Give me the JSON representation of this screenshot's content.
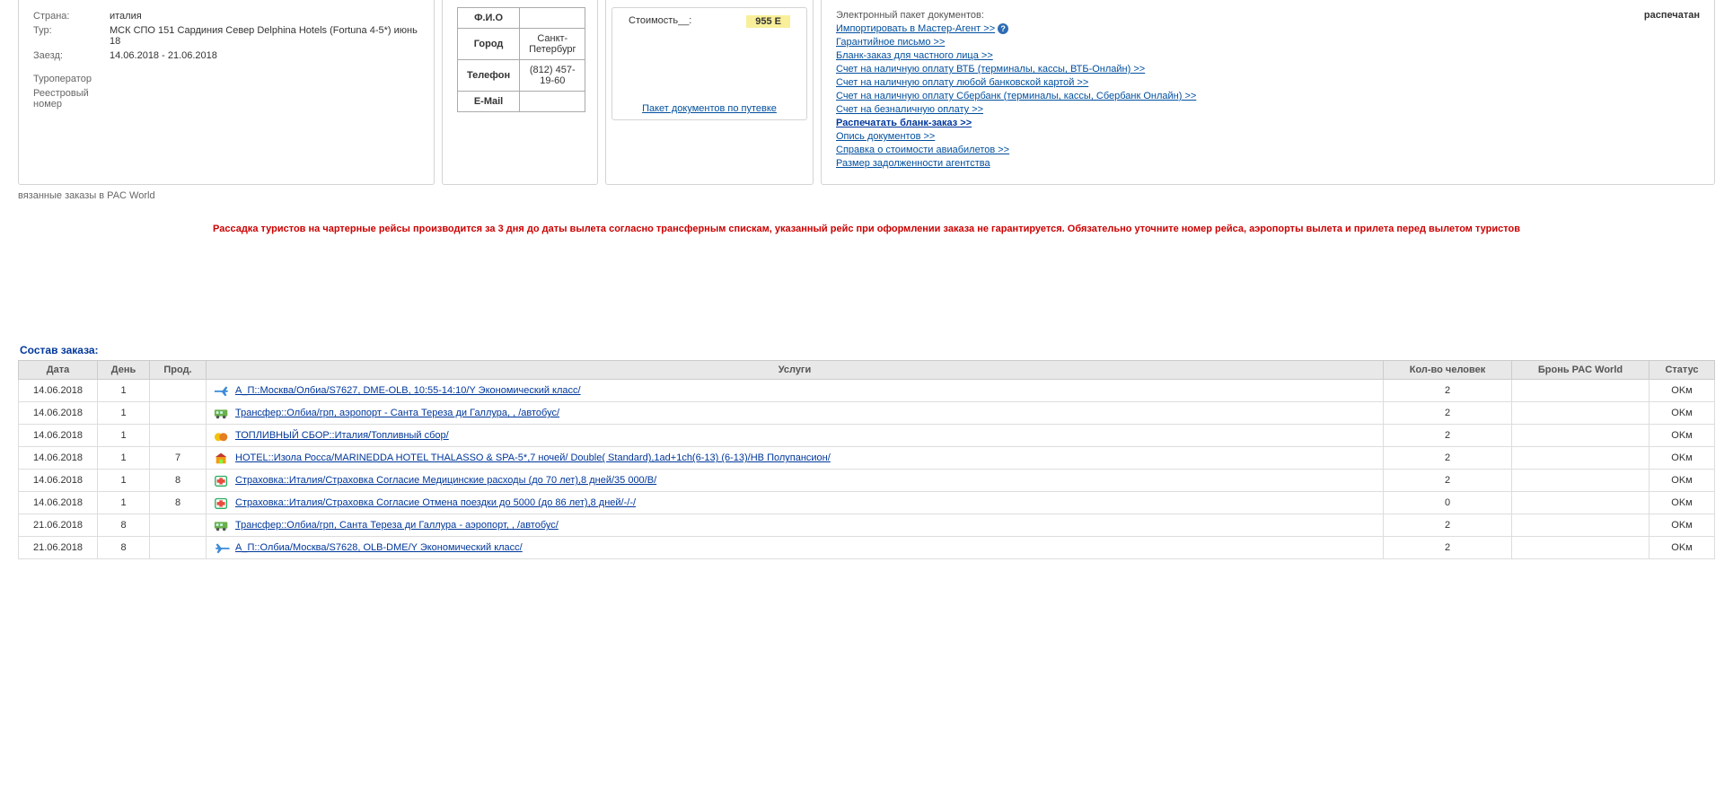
{
  "info": {
    "country_lbl": "Страна:",
    "country": "италия",
    "tour_lbl": "Тур:",
    "tour": "МСК СПО 151 Сардиния Север Delphina Hotels (Fortuna 4-5*) июнь 18",
    "check_lbl": "Заезд:",
    "check": "14.06.2018  -  21.06.2018",
    "operator_lbl": "Туроператор",
    "reg_lbl": "Реестровый номер"
  },
  "contact": {
    "fio_lbl": "Ф.И.О",
    "fio": "",
    "city_lbl": "Город",
    "city": "Санкт-Петербург",
    "phone_lbl": "Телефон",
    "phone": "(812) 457-19-60",
    "email_lbl": "E-Mail",
    "email": ""
  },
  "cost": {
    "lbl": "Стоимость__:",
    "val": "955 E",
    "pkg": "Пакет документов по путевке"
  },
  "docs": {
    "head_lbl": "Электронный пакет документов:",
    "head_val": "распечатан",
    "l1": "Импортировать в Мастер-Агент >>",
    "l2": "Гарантийное письмо >>",
    "l3": "Бланк-заказ для частного лица >>",
    "l4": "Счет на наличную оплату ВТБ (терминалы, кассы, ВТБ-Онлайн) >>",
    "l5": "Счет на наличную оплату любой банковской картой >>",
    "l6": "Счет на наличную оплату Сбербанк (терминалы, кассы, Сбербанк Онлайн) >>",
    "l7": "Счет на безналичную оплату >>",
    "l8": "Распечатать бланк-заказ >>",
    "l9": "Опись документов >>",
    "l10": "Справка о стоимости авиабилетов >>",
    "l11": "Размер задолженности агентства"
  },
  "linked": "вязанные заказы в PAC World",
  "warn": "Рассадка туристов на чартерные рейсы производится за 3 дня до даты вылета согласно трансферным спискам, указанный рейс при оформлении заказа не гарантируется. Обязательно уточните номер рейса, аэропорты вылета и прилета перед вылетом туристов",
  "order_title": "Состав заказа:",
  "cols": {
    "date": "Дата",
    "day": "День",
    "dur": "Прод.",
    "svc": "Услуги",
    "pax": "Кол-во человек",
    "book": "Бронь PAC World",
    "st": "Статус"
  },
  "rows": [
    {
      "d": "14.06.2018",
      "day": "1",
      "dur": "",
      "svc": "А_П::Москва/Олбиа/S7627, DME-OLB, 10:55-14:10/Y Экономический класс/",
      "pax": "2",
      "b": "",
      "s": "OKм",
      "ic": "plane-r"
    },
    {
      "d": "14.06.2018",
      "day": "1",
      "dur": "",
      "svc": "Трансфер::Олбиа/грп, аэропорт - Санта Тереза ди Галлура, , /автобус/",
      "pax": "2",
      "b": "",
      "s": "OKм",
      "ic": "bus"
    },
    {
      "d": "14.06.2018",
      "day": "1",
      "dur": "",
      "svc": "ТОПЛИВНЫЙ СБОР::Италия/Топливный сбор/",
      "pax": "2",
      "b": "",
      "s": "OKм",
      "ic": "fuel"
    },
    {
      "d": "14.06.2018",
      "day": "1",
      "dur": "7",
      "svc": "HOTEL::Изола Росса/MARINEDDA HOTEL THALASSO & SPA-5*,7 ночей/ Double( Standard),1ad+1ch(6-13) (6-13)/HB Полупансион/",
      "pax": "2",
      "b": "",
      "s": "OKм",
      "ic": "hotel"
    },
    {
      "d": "14.06.2018",
      "day": "1",
      "dur": "8",
      "svc": "Страховка::Италия/Страховка Согласие Медицинские расходы (до 70 лет),8 дней/35 000/B/",
      "pax": "2",
      "b": "",
      "s": "OKм",
      "ic": "ins"
    },
    {
      "d": "14.06.2018",
      "day": "1",
      "dur": "8",
      "svc": "Страховка::Италия/Страховка Согласие Отмена поездки до 5000 (до 86 лет),8 дней/-/-/",
      "pax": "0",
      "b": "",
      "s": "OKм",
      "ic": "ins"
    },
    {
      "d": "21.06.2018",
      "day": "8",
      "dur": "",
      "svc": "Трансфер::Олбиа/грп, Санта Тереза ди Галлура - аэропорт, , /автобус/",
      "pax": "2",
      "b": "",
      "s": "OKм",
      "ic": "bus"
    },
    {
      "d": "21.06.2018",
      "day": "8",
      "dur": "",
      "svc": "А_П::Олбиа/Москва/S7628, OLB-DME/Y Экономический класс/",
      "pax": "2",
      "b": "",
      "s": "OKм",
      "ic": "plane-l"
    }
  ]
}
